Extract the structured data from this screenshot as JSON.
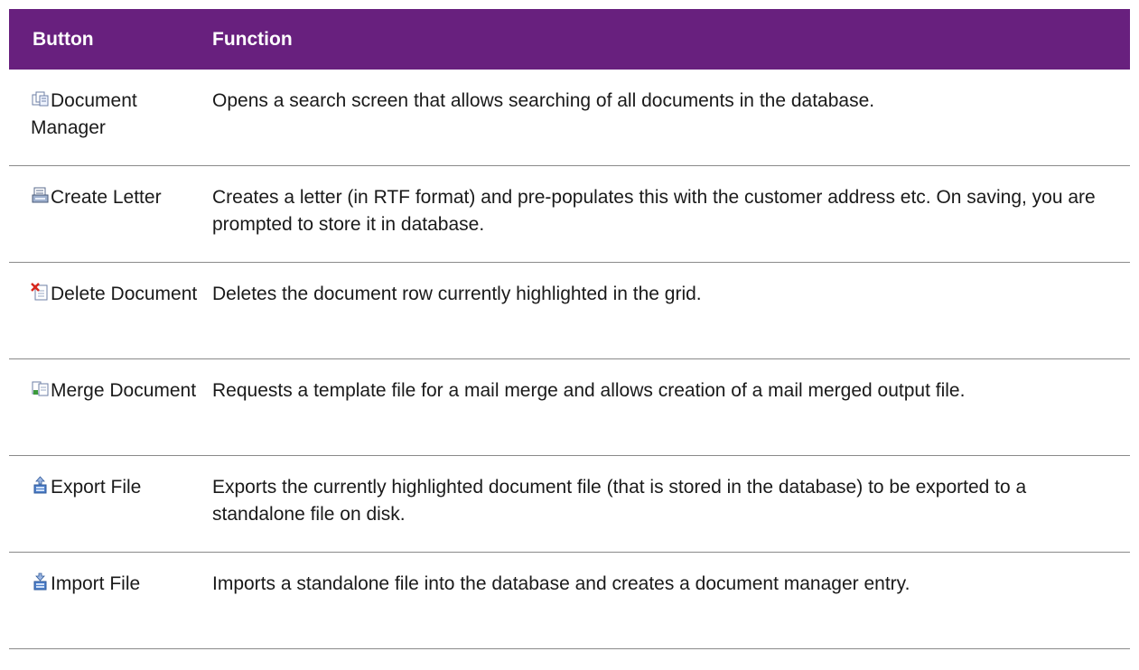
{
  "header": {
    "button_col": "Button",
    "function_col": "Function"
  },
  "rows": [
    {
      "icon": "document-manager-icon",
      "button": "Document Manager",
      "function": "Opens a search screen that allows searching of all documents in the database."
    },
    {
      "icon": "create-letter-icon",
      "button": "Create Letter",
      "function": "Creates a letter (in RTF format) and pre-populates this with the customer address etc. On saving, you are prompted to store it in database."
    },
    {
      "icon": "delete-document-icon",
      "button": "Delete Document",
      "function": "Deletes the document row currently highlighted in the grid."
    },
    {
      "icon": "merge-document-icon",
      "button": "Merge Document",
      "function": "Requests a template file for a mail merge and allows creation of a mail merged output file."
    },
    {
      "icon": "export-file-icon",
      "button": "Export File",
      "function": "Exports the currently highlighted document file (that is stored in the database) to be exported to a standalone file on disk."
    },
    {
      "icon": "import-file-icon",
      "button": "Import File",
      "function": "Imports a standalone file into the database and creates a document manager entry."
    }
  ],
  "colors": {
    "header_bg": "#68207e",
    "header_text": "#ffffff",
    "divider": "#8a8a8a"
  }
}
